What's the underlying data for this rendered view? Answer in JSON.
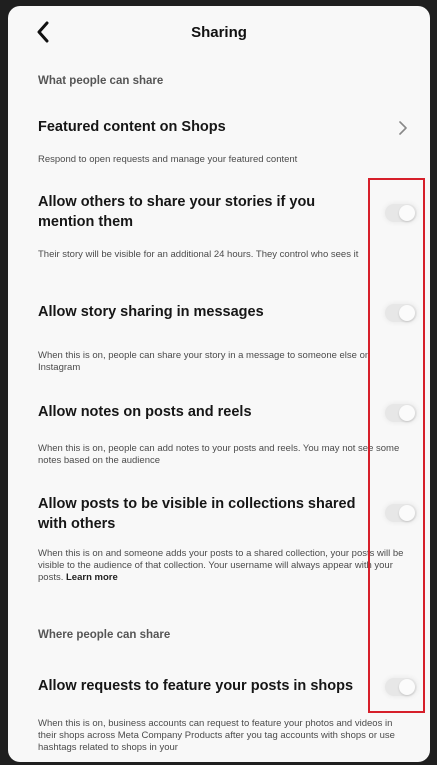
{
  "header": {
    "title": "Sharing",
    "back_icon": "chevron-left-icon"
  },
  "section1": {
    "title": "What people can share"
  },
  "featured": {
    "title": "Featured content on Shops",
    "description": "Respond to open requests and manage your featured content",
    "chevron_icon": "chevron-right-icon"
  },
  "settings": [
    {
      "title": "Allow others to share your stories if you mention them",
      "description": "Their story will be visible for an additional 24 hours. They control who sees it",
      "enabled": false
    },
    {
      "title": "Allow story sharing in messages",
      "description": "When this is on, people can share your story in a message to someone else on Instagram",
      "enabled": false
    },
    {
      "title": "Allow notes on posts and reels",
      "description": "When this is on, people can add notes to your posts and reels. You may not see some notes based on the audience",
      "enabled": false
    },
    {
      "title": "Allow posts to be visible in collections shared with others",
      "description": "When this is on and someone adds your posts to a shared collection, your posts will be visible to the audience of that collection. Your username will always appear with your posts.",
      "link": "Learn more",
      "enabled": false
    }
  ],
  "section2": {
    "title": "Where people can share"
  },
  "shops": {
    "title": "Allow requests to feature your posts in shops",
    "description": "When this is on, business accounts can request to feature your photos and videos in their shops across Meta Company Products after you tag accounts with shops or use hashtags related to shops in your",
    "enabled": false
  },
  "colors": {
    "highlight": "#d61f2a",
    "background": "#f8f8f8"
  }
}
